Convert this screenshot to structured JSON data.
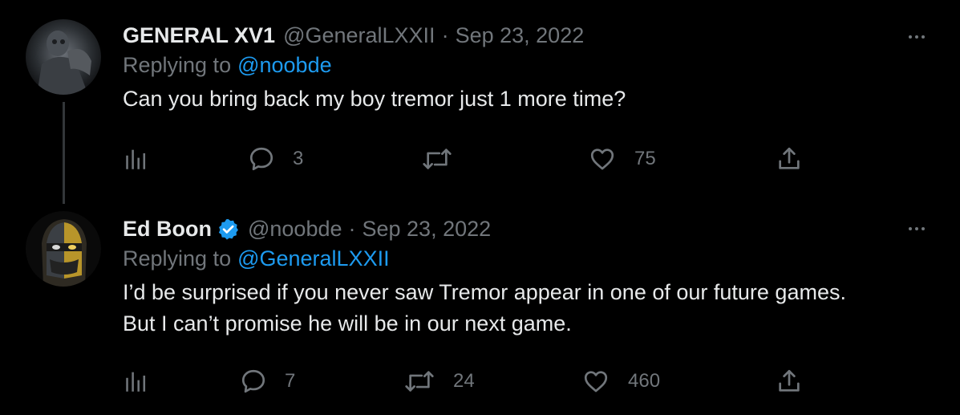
{
  "tweets": [
    {
      "display_name": "GENERAL XV1",
      "handle": "@GeneralLXXII",
      "separator": "·",
      "date": "Sep 23, 2022",
      "verified": false,
      "replying_prefix": "Replying to",
      "replying_to": "@noobde",
      "text": "Can you bring back my boy tremor just 1 more time?",
      "stats": {
        "views": "",
        "replies": "3",
        "retweets": "",
        "likes": "75"
      },
      "avatar_icon": "dark-warrior-avatar"
    },
    {
      "display_name": "Ed Boon",
      "handle": "@noobde",
      "separator": "·",
      "date": "Sep 23, 2022",
      "verified": true,
      "replying_prefix": "Replying to",
      "replying_to": "@GeneralLXXII",
      "text": "I’d be surprised if you never saw Tremor appear in one of our future games.\nBut I can’t promise he will be in our next game.",
      "stats": {
        "views": "",
        "replies": "7",
        "retweets": "24",
        "likes": "460"
      },
      "avatar_icon": "masked-ninja-avatar"
    }
  ],
  "icons": {
    "views": "bar-chart-icon",
    "reply": "speech-bubble-icon",
    "retweet": "retweet-arrows-icon",
    "like": "heart-icon",
    "share": "share-upload-icon",
    "more": "ellipsis-icon",
    "verified": "verified-badge-icon"
  },
  "colors": {
    "background": "#000000",
    "text_primary": "#e7e9ea",
    "text_secondary": "#71767b",
    "accent": "#1d9bf0",
    "thread_line": "#333639"
  }
}
